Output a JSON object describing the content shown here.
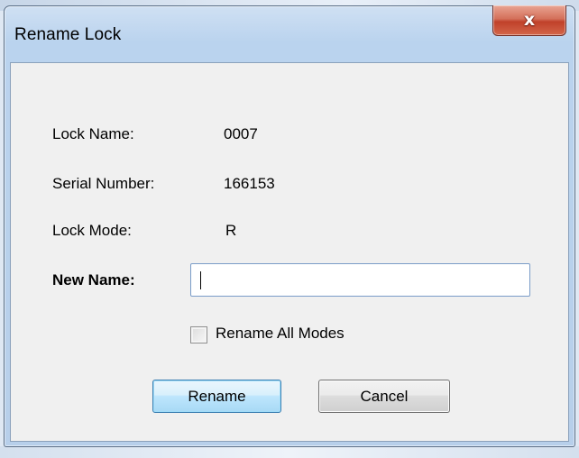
{
  "window": {
    "title": "Rename Lock",
    "close_glyph": "x"
  },
  "fields": {
    "lock_name_label": "Lock Name:",
    "lock_name_value": "0007",
    "serial_label": "Serial Number:",
    "serial_value": "166153",
    "mode_label": "Lock Mode:",
    "mode_value": "R",
    "new_name_label": "New Name:",
    "new_name_value": ""
  },
  "options": {
    "rename_all_label": "Rename All Modes",
    "rename_all_checked": false
  },
  "buttons": {
    "rename": "Rename",
    "cancel": "Cancel"
  },
  "colors": {
    "title_bar": "#bad3ee",
    "close_button": "#c0412a",
    "client_bg": "#f0f0f0",
    "default_button": "#bee6fd"
  }
}
